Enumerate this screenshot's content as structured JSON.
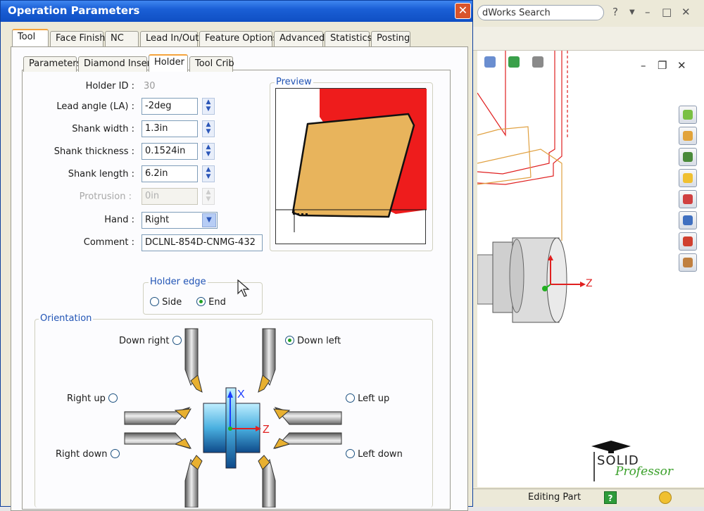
{
  "cad": {
    "search_text": "dWorks Search",
    "status_text": "Editing Part",
    "help_glyph": "?",
    "axis_label": "Z",
    "logo_line1": "SOLID",
    "logo_line2": "Professor"
  },
  "dialog": {
    "title": "Operation Parameters",
    "close_glyph": "✕",
    "tabs": [
      "Tool",
      "Face Finish",
      "NC",
      "Lead In/Out",
      "Feature Options",
      "Advanced",
      "Statistics",
      "Posting"
    ],
    "subtabs": [
      "Parameters",
      "Diamond Insert",
      "Holder",
      "Tool Crib"
    ],
    "fields": {
      "holder_id_label": "Holder ID :",
      "holder_id_value": "30",
      "lead_angle_label": "Lead angle (LA) :",
      "lead_angle_value": "-2deg",
      "shank_width_label": "Shank width :",
      "shank_width_value": "1.3in",
      "shank_thickness_label": "Shank thickness :",
      "shank_thickness_value": "0.1524in",
      "shank_length_label": "Shank length :",
      "shank_length_value": "6.2in",
      "protrusion_label": "Protrusion :",
      "protrusion_value": "0in",
      "hand_label": "Hand :",
      "hand_value": "Right",
      "comment_label": "Comment :",
      "comment_value": "DCLNL-854D-CNMG-432"
    },
    "preview_title": "Preview",
    "holder_edge": {
      "title": "Holder edge",
      "side_label": "Side",
      "end_label": "End",
      "selected": "End"
    },
    "orientation": {
      "title": "Orientation",
      "down_right": "Down right",
      "down_left": "Down left",
      "right_up": "Right up",
      "left_up": "Left up",
      "right_down": "Right down",
      "left_down": "Left down",
      "selected": "Down left",
      "axis_x": "X",
      "axis_z": "Z"
    }
  },
  "colors": {
    "accent": "#2154b5",
    "preview_red": "#ee1c1c",
    "insert": "#e8b45c"
  }
}
